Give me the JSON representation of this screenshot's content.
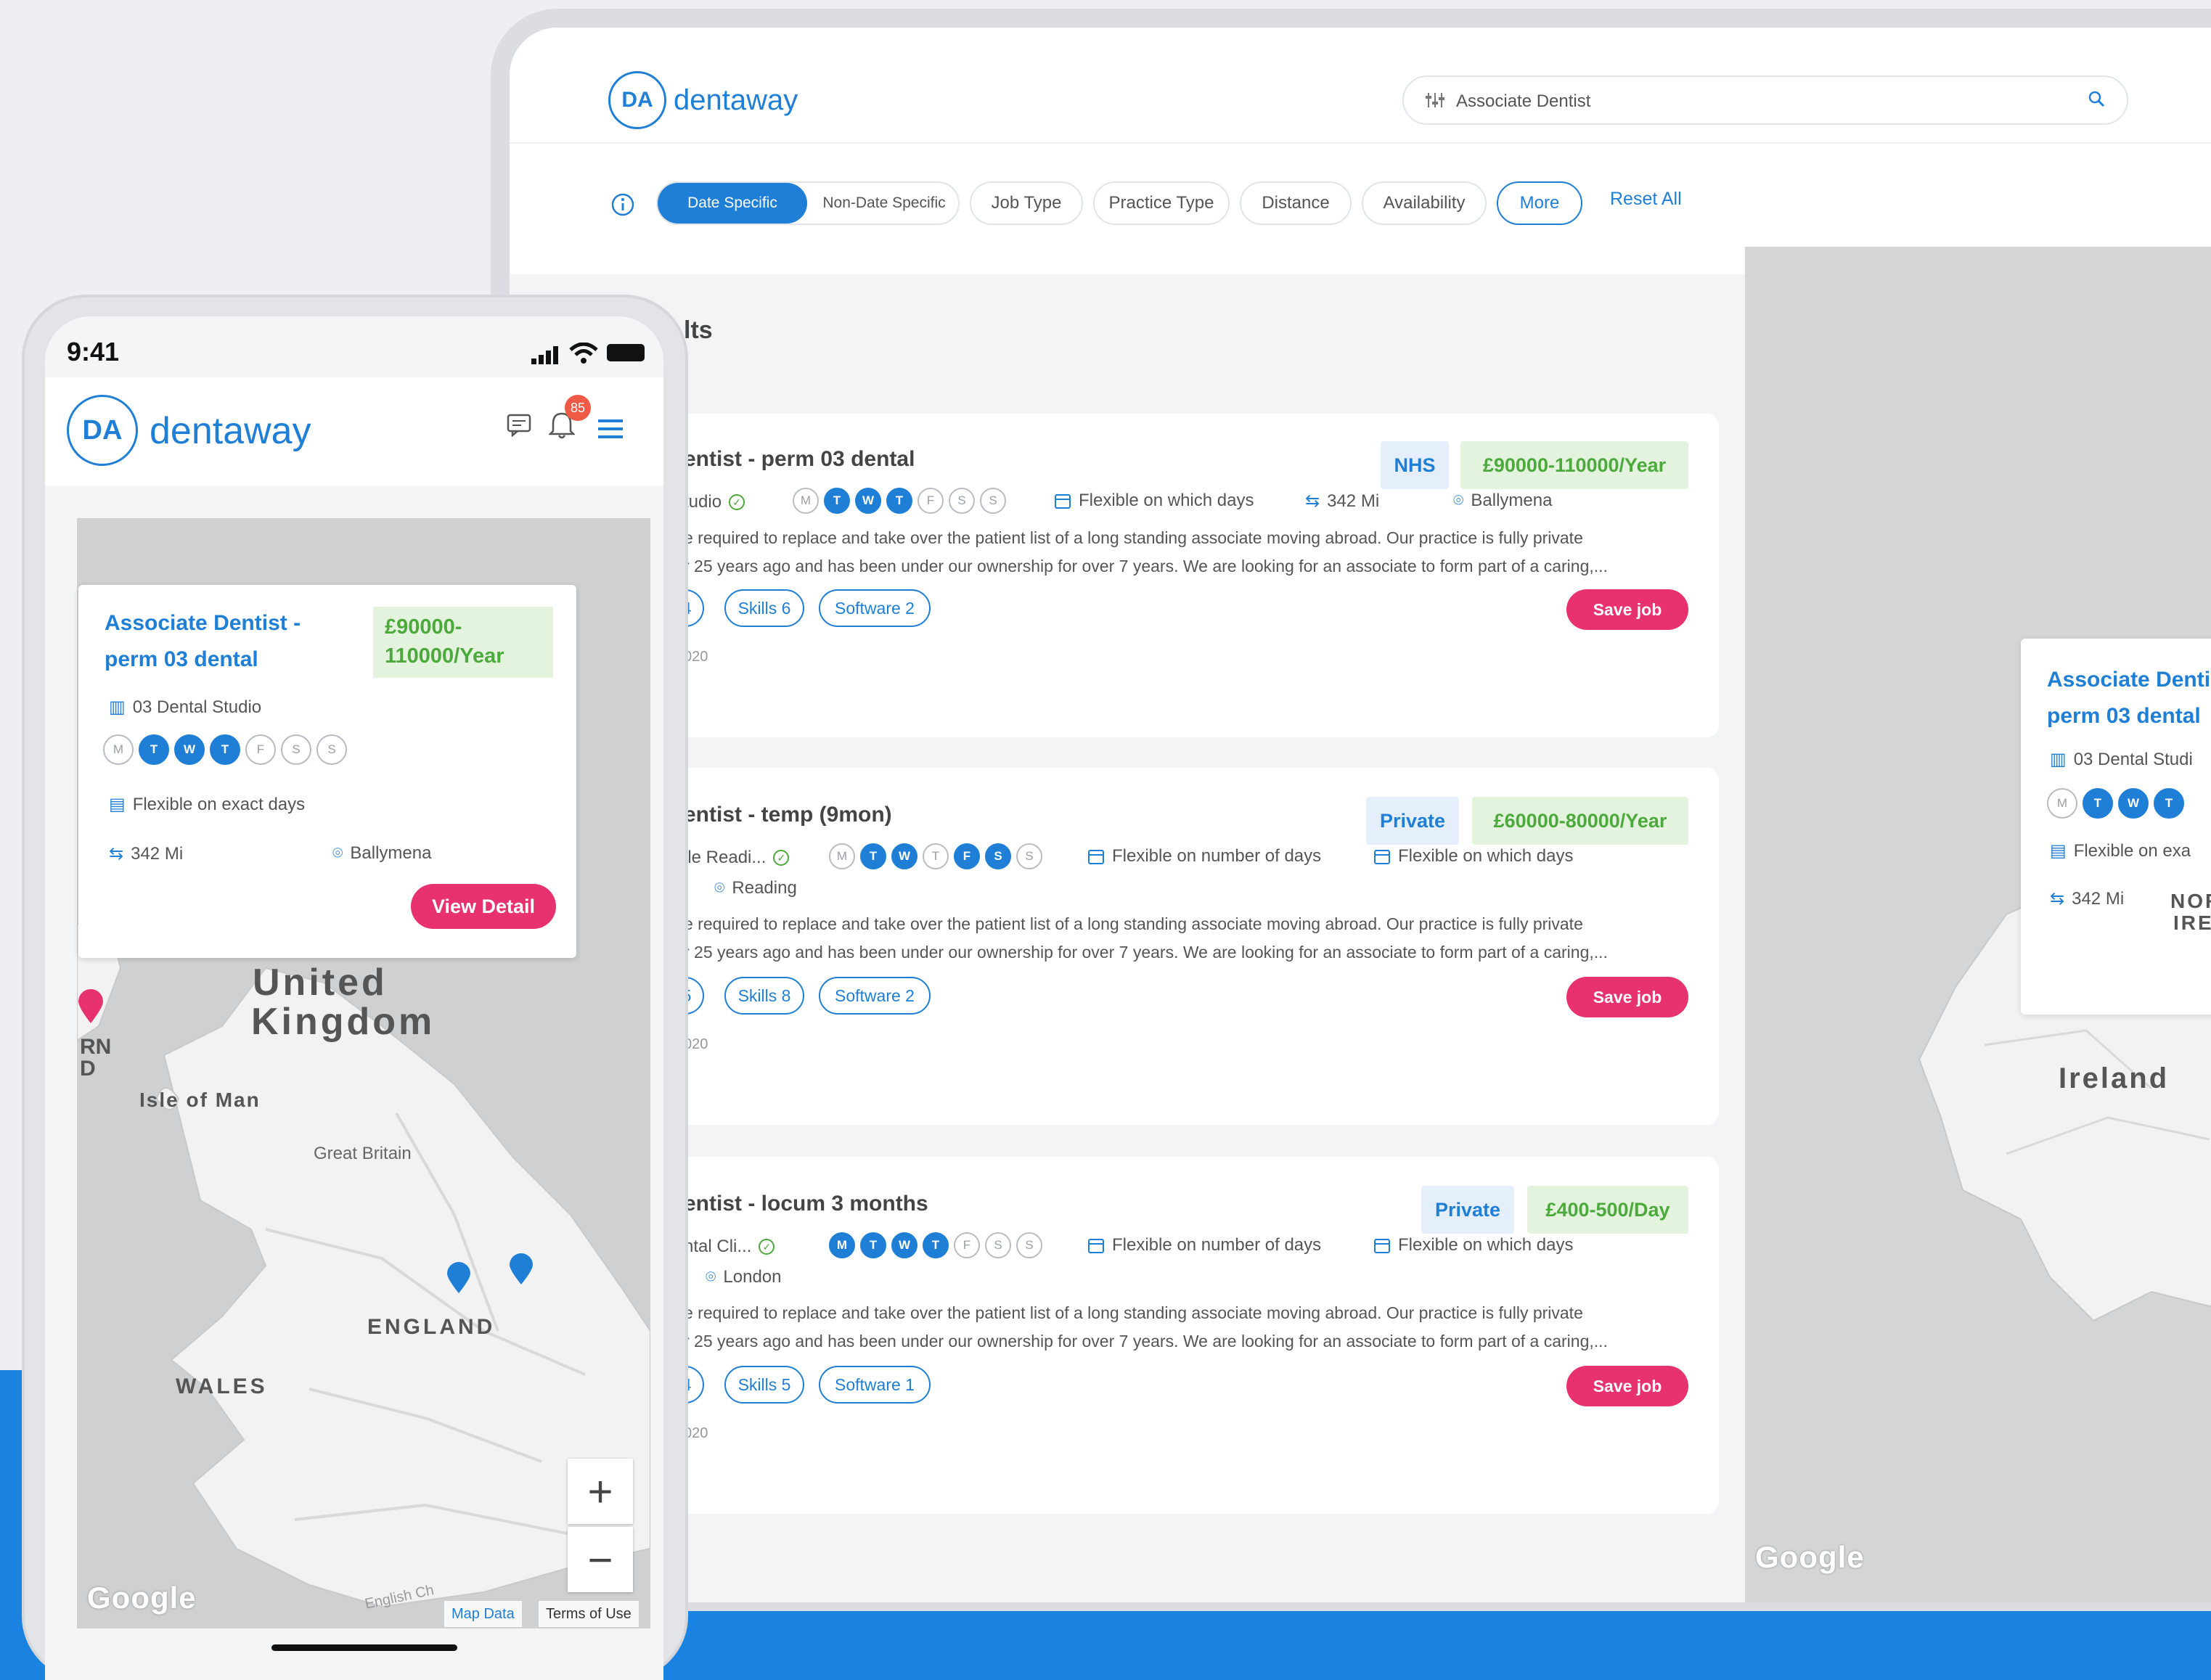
{
  "desktop": {
    "brand": "dentaway",
    "brand_mark": "DA",
    "search": {
      "value": "Associate Dentist"
    },
    "filters": {
      "date_specific": "Date Specific",
      "non_date_specific": "Non-Date Specific",
      "job_type": "Job Type",
      "practice_type": "Practice Type",
      "distance": "Distance",
      "availability": "Availability",
      "more": "More",
      "reset_all": "Reset All"
    },
    "results_title": "lts",
    "jobs": [
      {
        "title": "entist - perm 03 dental",
        "type": "NHS",
        "salary": "£90000-110000/Year",
        "practice": "tudio",
        "days": [
          {
            "l": "M",
            "on": false
          },
          {
            "l": "T",
            "on": true
          },
          {
            "l": "W",
            "on": true
          },
          {
            "l": "T",
            "on": true
          },
          {
            "l": "F",
            "on": false
          },
          {
            "l": "S",
            "on": false
          },
          {
            "l": "S",
            "on": false
          }
        ],
        "flex1": "Flexible on which days",
        "distance": "342 Mi",
        "location": "Ballymena",
        "desc1": "e required to replace and take over the patient list of a long standing associate moving abroad. Our practice is fully private",
        "desc2": "r 25 years ago and has been under our ownership for over 7 years. We are looking for an associate to form part of a caring,...",
        "tag0": "4",
        "skills": "Skills 6",
        "software": "Software 2",
        "date": "020",
        "save": "Save job"
      },
      {
        "title": "entist - temp (9mon)",
        "type": "Private",
        "salary": "£60000-80000/Year",
        "practice": "ile Readi...",
        "location": "Reading",
        "days": [
          {
            "l": "M",
            "on": false
          },
          {
            "l": "T",
            "on": true
          },
          {
            "l": "W",
            "on": true
          },
          {
            "l": "T",
            "on": false
          },
          {
            "l": "F",
            "on": true
          },
          {
            "l": "S",
            "on": true
          },
          {
            "l": "S",
            "on": false
          }
        ],
        "flex1": "Flexible on number of days",
        "flex2": "Flexible on which days",
        "desc1": "e required to replace and take over the patient list of a long standing associate moving abroad. Our practice is fully private",
        "desc2": "r 25 years ago and has been under our ownership for over 7 years. We are looking for an associate to form part of a caring,...",
        "tag0": "5",
        "skills": "Skills 8",
        "software": "Software 2",
        "date": "020",
        "save": "Save job"
      },
      {
        "title": "entist - locum 3 months",
        "type": "Private",
        "salary": "£400-500/Day",
        "practice": "ntal Cli...",
        "location": "London",
        "days": [
          {
            "l": "M",
            "on": true
          },
          {
            "l": "T",
            "on": true
          },
          {
            "l": "W",
            "on": true
          },
          {
            "l": "T",
            "on": true
          },
          {
            "l": "F",
            "on": false
          },
          {
            "l": "S",
            "on": false
          },
          {
            "l": "S",
            "on": false
          }
        ],
        "flex1": "Flexible on number of days",
        "flex2": "Flexible on which days",
        "desc1": "e required to replace and take over the patient list of a long standing associate moving abroad. Our practice is fully private",
        "desc2": "r 25 years ago and has been under our ownership for over 7 years. We are looking for an associate to form part of a caring,...",
        "tag0": "4",
        "skills": "Skills 5",
        "software": "Software 1",
        "date": "020",
        "save": "Save job"
      }
    ],
    "map": {
      "card_title_1": "Associate Denti",
      "card_title_2": "perm 03 dental",
      "card_practice": "03 Dental Studi",
      "card_days": [
        {
          "l": "M",
          "on": false
        },
        {
          "l": "T",
          "on": true
        },
        {
          "l": "W",
          "on": true
        },
        {
          "l": "T",
          "on": true
        }
      ],
      "card_flex": "Flexible on exa",
      "card_distance": "342 Mi",
      "label_north_1": "NOR",
      "label_north_2": "IRE",
      "label_ireland": "Ireland",
      "google": "Google"
    }
  },
  "phone": {
    "time": "9:41",
    "brand": "dentaway",
    "brand_mark": "DA",
    "notif_count": "85",
    "card": {
      "title_1": "Associate Dentist -",
      "title_2": "perm 03 dental",
      "salary_1": "£90000-",
      "salary_2": "110000/Year",
      "practice": "03 Dental Studio",
      "days": [
        {
          "l": "M",
          "on": false
        },
        {
          "l": "T",
          "on": true
        },
        {
          "l": "W",
          "on": true
        },
        {
          "l": "T",
          "on": true
        },
        {
          "l": "F",
          "on": false
        },
        {
          "l": "S",
          "on": false
        },
        {
          "l": "S",
          "on": false
        }
      ],
      "flex": "Flexible on exact days",
      "distance": "342 Mi",
      "location": "Ballymena",
      "button": "View Detail"
    },
    "map": {
      "uk_1": "United",
      "uk_2": "Kingdom",
      "rn": "RN",
      "d": "D",
      "isle_of_man": "Isle of Man",
      "great_britain": "Great Britain",
      "england": "ENGLAND",
      "wales": "WALES",
      "google": "Google",
      "english_channel": "English Ch",
      "map_data": "Map Data",
      "terms": "Terms of Use",
      "zoom_in": "+",
      "zoom_out": "−"
    }
  },
  "colors": {
    "brand_blue": "#1f7fd6",
    "save_pink": "#e8326f",
    "salary_green": "#4caa3c",
    "page_blue_band": "#1a82e0"
  }
}
